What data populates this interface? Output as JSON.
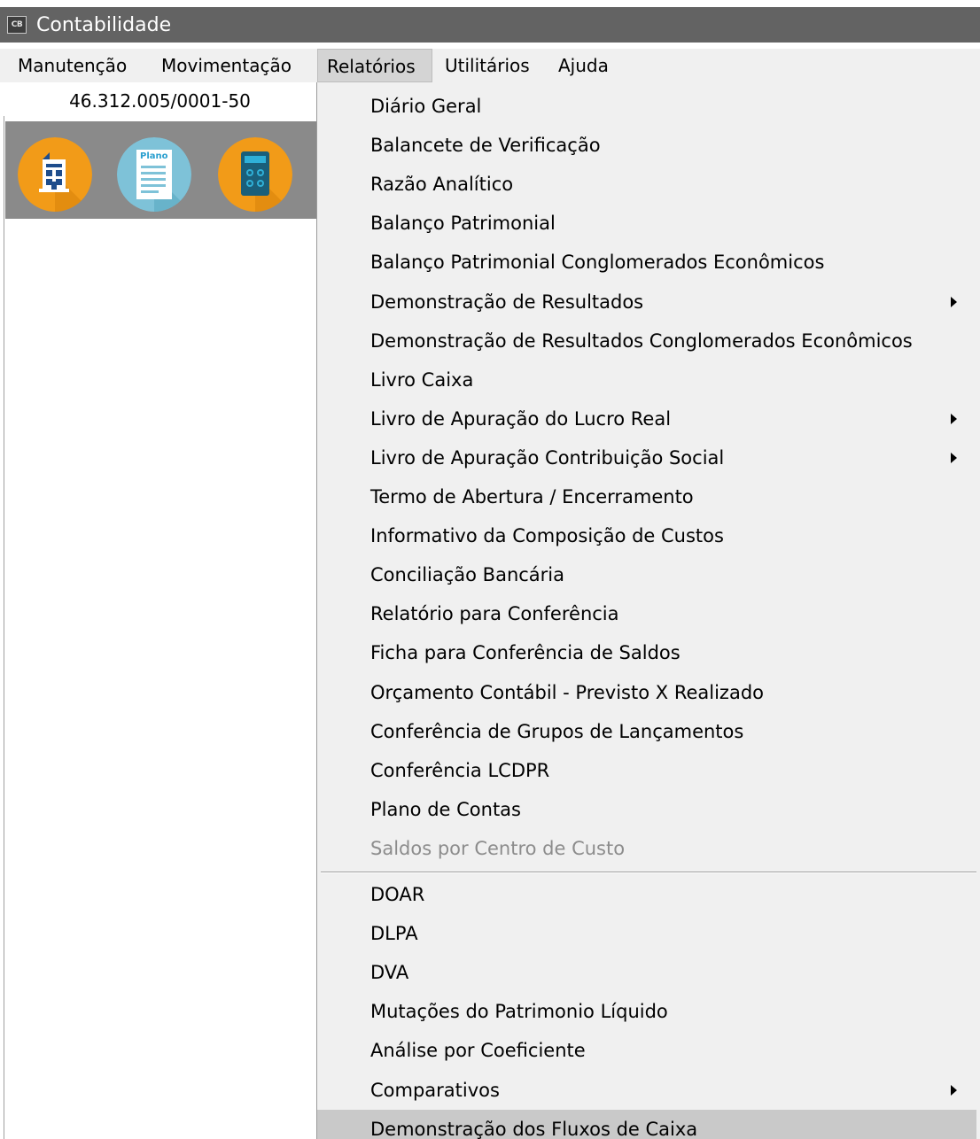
{
  "window": {
    "icon_label": "CB",
    "title": "Contabilidade"
  },
  "menubar": {
    "items": [
      "Manutenção",
      "Movimentação",
      "Relatórios",
      "Utilitários",
      "Ajuda"
    ],
    "active": "Relatórios"
  },
  "left_panel": {
    "company_id": "46.312.005/0001-50",
    "tool_icons": [
      {
        "icon": "building-icon",
        "color": "#f29b18"
      },
      {
        "icon": "document-plano-icon",
        "color": "#7ec2d8",
        "text": "Plano"
      },
      {
        "icon": "calculator-icon",
        "color": "#f29b18"
      }
    ]
  },
  "dropdown": {
    "section1": [
      {
        "label": "Diário Geral",
        "submenu": false,
        "enabled": true
      },
      {
        "label": "Balancete de Verificação",
        "submenu": false,
        "enabled": true
      },
      {
        "label": "Razão Analítico",
        "submenu": false,
        "enabled": true
      },
      {
        "label": "Balanço Patrimonial",
        "submenu": false,
        "enabled": true
      },
      {
        "label": "Balanço Patrimonial Conglomerados Econômicos",
        "submenu": false,
        "enabled": true
      },
      {
        "label": "Demonstração de Resultados",
        "submenu": true,
        "enabled": true
      },
      {
        "label": "Demonstração de Resultados Conglomerados Econômicos",
        "submenu": false,
        "enabled": true
      },
      {
        "label": "Livro Caixa",
        "submenu": false,
        "enabled": true
      },
      {
        "label": "Livro de Apuração do Lucro Real",
        "submenu": true,
        "enabled": true
      },
      {
        "label": "Livro de Apuração Contribuição Social",
        "submenu": true,
        "enabled": true
      },
      {
        "label": "Termo de Abertura / Encerramento",
        "submenu": false,
        "enabled": true
      },
      {
        "label": "Informativo da Composição de Custos",
        "submenu": false,
        "enabled": true
      },
      {
        "label": "Conciliação Bancária",
        "submenu": false,
        "enabled": true
      },
      {
        "label": "Relatório para Conferência",
        "submenu": false,
        "enabled": true
      },
      {
        "label": "Ficha para Conferência de Saldos",
        "submenu": false,
        "enabled": true
      },
      {
        "label": "Orçamento Contábil - Previsto X Realizado",
        "submenu": false,
        "enabled": true
      },
      {
        "label": "Conferência de Grupos de Lançamentos",
        "submenu": false,
        "enabled": true
      },
      {
        "label": "Conferência LCDPR",
        "submenu": false,
        "enabled": true
      },
      {
        "label": "Plano de Contas",
        "submenu": false,
        "enabled": true
      },
      {
        "label": "Saldos por Centro de Custo",
        "submenu": false,
        "enabled": false
      }
    ],
    "section2": [
      {
        "label": "DOAR",
        "submenu": false,
        "enabled": true
      },
      {
        "label": "DLPA",
        "submenu": false,
        "enabled": true
      },
      {
        "label": "DVA",
        "submenu": false,
        "enabled": true
      },
      {
        "label": "Mutações do Patrimonio Líquido",
        "submenu": false,
        "enabled": true
      },
      {
        "label": "Análise por Coeficiente",
        "submenu": false,
        "enabled": true
      },
      {
        "label": "Comparativos",
        "submenu": true,
        "enabled": true
      },
      {
        "label": "Demonstração dos Fluxos de Caixa",
        "submenu": false,
        "enabled": true,
        "highlighted": true
      }
    ]
  }
}
